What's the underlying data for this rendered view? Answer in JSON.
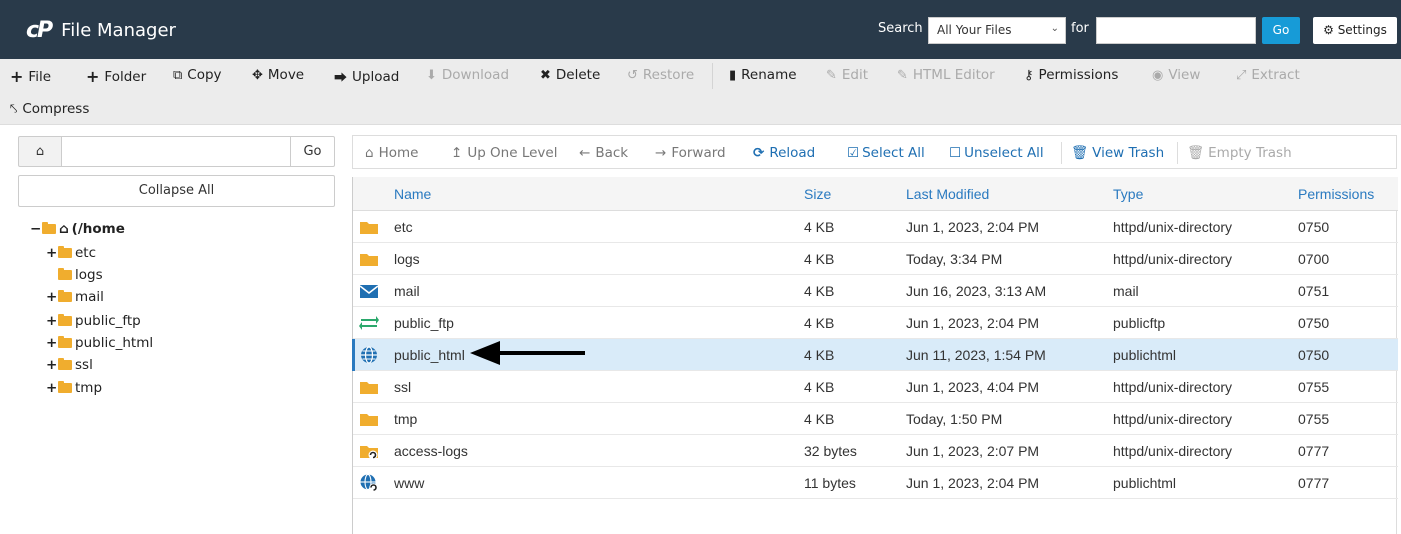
{
  "app": {
    "logo": "cP",
    "title": "File Manager"
  },
  "search": {
    "label": "Search",
    "scope": "All Your Files",
    "for_label": "for",
    "go_label": "Go",
    "query": ""
  },
  "settings": {
    "label": "Settings"
  },
  "toolbar": {
    "file": "File",
    "folder": "Folder",
    "copy": "Copy",
    "move": "Move",
    "upload": "Upload",
    "download": "Download",
    "delete": "Delete",
    "restore": "Restore",
    "rename": "Rename",
    "edit": "Edit",
    "html_editor": "HTML Editor",
    "permissions": "Permissions",
    "view": "View",
    "extract": "Extract",
    "compress": "Compress"
  },
  "sidebar": {
    "path_value": "",
    "go_label": "Go",
    "collapse_label": "Collapse All",
    "root_label": "(/home",
    "tree": [
      "etc",
      "logs",
      "mail",
      "public_ftp",
      "public_html",
      "ssl",
      "tmp"
    ]
  },
  "nav": {
    "home": "Home",
    "up": "Up One Level",
    "back": "Back",
    "forward": "Forward",
    "reload": "Reload",
    "select_all": "Select All",
    "unselect_all": "Unselect All",
    "view_trash": "View Trash",
    "empty_trash": "Empty Trash"
  },
  "table": {
    "columns": {
      "name": "Name",
      "size": "Size",
      "modified": "Last Modified",
      "type": "Type",
      "perms": "Permissions"
    },
    "rows": [
      {
        "icon": "folder-icon",
        "name": "etc",
        "size": "4 KB",
        "modified": "Jun 1, 2023, 2:04 PM",
        "type": "httpd/unix-directory",
        "perms": "0750"
      },
      {
        "icon": "folder-icon",
        "name": "logs",
        "size": "4 KB",
        "modified": "Today, 3:34 PM",
        "type": "httpd/unix-directory",
        "perms": "0700"
      },
      {
        "icon": "mail-icon",
        "name": "mail",
        "size": "4 KB",
        "modified": "Jun 16, 2023, 3:13 AM",
        "type": "mail",
        "perms": "0751"
      },
      {
        "icon": "exchange-icon",
        "name": "public_ftp",
        "size": "4 KB",
        "modified": "Jun 1, 2023, 2:04 PM",
        "type": "publicftp",
        "perms": "0750"
      },
      {
        "icon": "globe-icon",
        "name": "public_html",
        "size": "4 KB",
        "modified": "Jun 11, 2023, 1:54 PM",
        "type": "publichtml",
        "perms": "0750"
      },
      {
        "icon": "folder-icon",
        "name": "ssl",
        "size": "4 KB",
        "modified": "Jun 1, 2023, 4:04 PM",
        "type": "httpd/unix-directory",
        "perms": "0755"
      },
      {
        "icon": "folder-icon",
        "name": "tmp",
        "size": "4 KB",
        "modified": "Today, 1:50 PM",
        "type": "httpd/unix-directory",
        "perms": "0755"
      },
      {
        "icon": "folder-link-icon",
        "name": "access-logs",
        "size": "32 bytes",
        "modified": "Jun 1, 2023, 2:07 PM",
        "type": "httpd/unix-directory",
        "perms": "0777"
      },
      {
        "icon": "globe-link-icon",
        "name": "www",
        "size": "11 bytes",
        "modified": "Jun 1, 2023, 2:04 PM",
        "type": "publichtml",
        "perms": "0777"
      }
    ]
  },
  "colors": {
    "header_bg": "#293a4a",
    "accent": "#179bd7",
    "link": "#1f6fb2",
    "folder": "#f0ad2e",
    "selected_row": "#d9ebf9"
  }
}
